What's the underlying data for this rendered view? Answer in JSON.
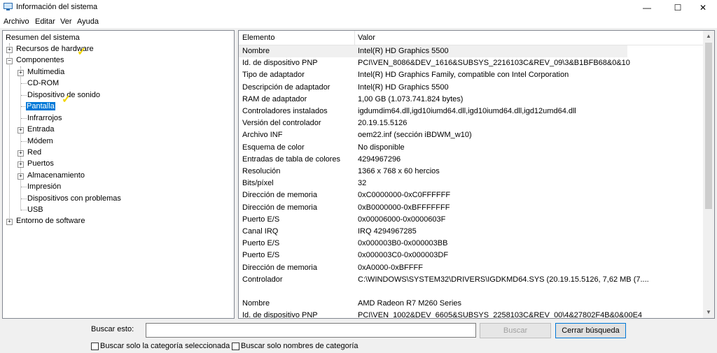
{
  "window": {
    "title": "Información del sistema",
    "minimize": "—",
    "maximize": "☐",
    "close": "✕"
  },
  "menu": [
    "Archivo",
    "Editar",
    "Ver",
    "Ayuda"
  ],
  "tree": {
    "root": "Resumen del sistema",
    "recursos": "Recursos de hardware",
    "componentes": "Componentes",
    "children": [
      "Multimedia",
      "CD-ROM",
      "Dispositivo de sonido",
      "Pantalla",
      "Infrarrojos",
      "Entrada",
      "Módem",
      "Red",
      "Puertos",
      "Almacenamiento",
      "Impresión",
      "Dispositivos con problemas",
      "USB"
    ],
    "entorno": "Entorno de software",
    "selected": "Pantalla"
  },
  "table": {
    "headers": {
      "element": "Elemento",
      "value": "Valor"
    },
    "rows": [
      {
        "element": "Nombre",
        "value": "Intel(R) HD Graphics 5500"
      },
      {
        "element": "Id. de dispositivo PNP",
        "value": "PCI\\VEN_8086&DEV_1616&SUBSYS_2216103C&REV_09\\3&B1BFB68&0&10"
      },
      {
        "element": "Tipo de adaptador",
        "value": "Intel(R) HD Graphics Family, compatible con Intel Corporation"
      },
      {
        "element": "Descripción de adaptador",
        "value": "Intel(R) HD Graphics 5500"
      },
      {
        "element": "RAM de adaptador",
        "value": "1,00 GB (1.073.741.824 bytes)"
      },
      {
        "element": "Controladores instalados",
        "value": "igdumdim64.dll,igd10iumd64.dll,igd10iumd64.dll,igd12umd64.dll"
      },
      {
        "element": "Versión del controlador",
        "value": "20.19.15.5126"
      },
      {
        "element": "Archivo INF",
        "value": "oem22.inf (sección iBDWM_w10)"
      },
      {
        "element": "Esquema de color",
        "value": "No disponible"
      },
      {
        "element": "Entradas de tabla de colores",
        "value": "4294967296"
      },
      {
        "element": "Resolución",
        "value": "1366 x 768 x 60 hercios"
      },
      {
        "element": "Bits/píxel",
        "value": "32"
      },
      {
        "element": "Dirección de memoria",
        "value": "0xC0000000-0xC0FFFFFF"
      },
      {
        "element": "Dirección de memoria",
        "value": "0xB0000000-0xBFFFFFFF"
      },
      {
        "element": "Puerto E/S",
        "value": "0x00006000-0x0000603F"
      },
      {
        "element": "Canal IRQ",
        "value": "IRQ 4294967285"
      },
      {
        "element": "Puerto E/S",
        "value": "0x000003B0-0x000003BB"
      },
      {
        "element": "Puerto E/S",
        "value": "0x000003C0-0x000003DF"
      },
      {
        "element": "Dirección de memoria",
        "value": "0xA0000-0xBFFFF"
      },
      {
        "element": "Controlador",
        "value": "C:\\WINDOWS\\SYSTEM32\\DRIVERS\\IGDKMD64.SYS (20.19.15.5126, 7,62 MB (7...."
      },
      {
        "element": "",
        "value": ""
      },
      {
        "element": "Nombre",
        "value": "AMD Radeon R7 M260 Series"
      },
      {
        "element": "Id. de dispositivo PNP",
        "value": "PCI\\VEN_1002&DEV_6605&SUBSYS_2258103C&REV_00\\4&27802F4B&0&00E4"
      }
    ]
  },
  "search": {
    "label": "Buscar esto:",
    "value": "",
    "find_button": "Buscar",
    "close_button": "Cerrar búsqueda",
    "cb_category": "Buscar solo la categoría seleccionada",
    "cb_names": "Buscar solo nombres de categoría"
  },
  "colors": {
    "selection": "#0078d7",
    "annotation": "#f2d500"
  }
}
